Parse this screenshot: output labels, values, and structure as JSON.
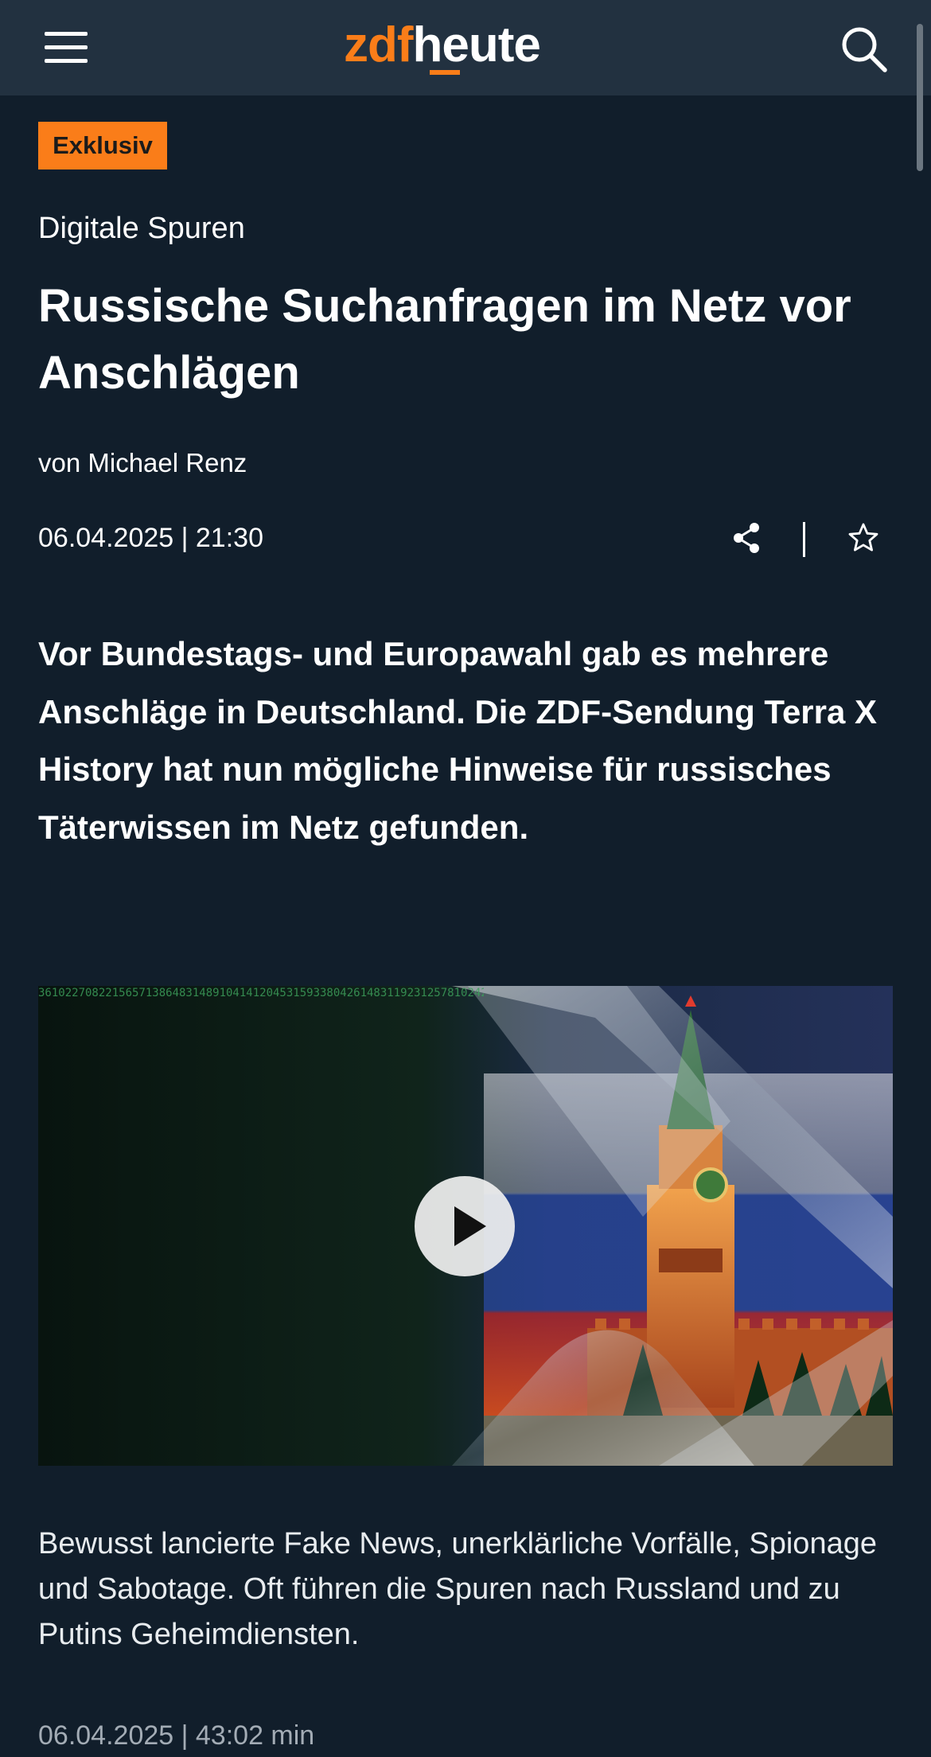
{
  "header": {
    "logo_part1": "zdf",
    "logo_part2": "heute",
    "menu_icon": "hamburger-menu-icon",
    "search_icon": "search-icon"
  },
  "article": {
    "badge": "Exklusiv",
    "kicker": "Digitale Spuren",
    "headline": "Russische Suchanfragen im Netz vor Anschlägen",
    "author": "von Michael Renz",
    "datetime": "06.04.2025 | 21:30",
    "lead": "Vor Bundestags- und Europawahl gab es mehrere Anschläge in Deutschland. Die ZDF-Sendung Terra X History hat nun mögliche Hinweise für russisches Täterwissen im Netz gefunden.",
    "share_icon": "share-icon",
    "bookmark_icon": "star-icon"
  },
  "video": {
    "play_icon": "play-icon",
    "caption": "Bewusst lancierte Fake News, unerklärliche Vorfälle, Spionage und Sabotage. Oft führen die Spuren nach Russland und zu Putins Geheimdiensten.",
    "meta": "06.04.2025 | 43:02 min"
  },
  "colors": {
    "background": "#111e2b",
    "topbar": "#223140",
    "accent": "#fa7d19"
  }
}
